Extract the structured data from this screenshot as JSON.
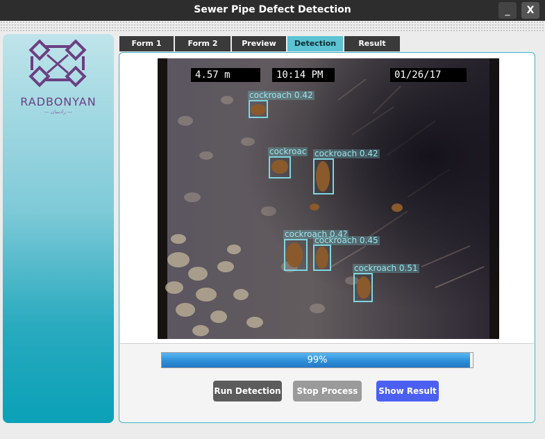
{
  "window": {
    "title": "Sewer Pipe Defect Detection",
    "minimize_label": "_",
    "close_label": "X"
  },
  "sidebar": {
    "logo_text": "RADBONYAN",
    "logo_subtext": "— رادبنیان —"
  },
  "tabs": [
    {
      "label": "Form 1",
      "active": false
    },
    {
      "label": "Form 2",
      "active": false
    },
    {
      "label": "Preview",
      "active": false
    },
    {
      "label": "Detection",
      "active": true
    },
    {
      "label": "Result",
      "active": false
    }
  ],
  "image": {
    "osd_distance": "4.57 m",
    "osd_time": "10:14 PM",
    "osd_date": "01/26/17",
    "detections": [
      {
        "label": "cockroach 0.42"
      },
      {
        "label": "cockroac"
      },
      {
        "label": "cockroach 0.42"
      },
      {
        "label": "cockroach 0.4?"
      },
      {
        "label": "cockroach 0.45"
      },
      {
        "label": "cockroach 0.51"
      }
    ]
  },
  "progress": {
    "value": 0.99,
    "text": "99%"
  },
  "buttons": {
    "run": "Run Detection",
    "stop": "Stop Process",
    "show": "Show Result"
  },
  "colors": {
    "accent": "#5bc3d2",
    "detection_box": "#7fd6e0",
    "show_button": "#4b60f2",
    "progress_fill": "#2f8fd8"
  }
}
